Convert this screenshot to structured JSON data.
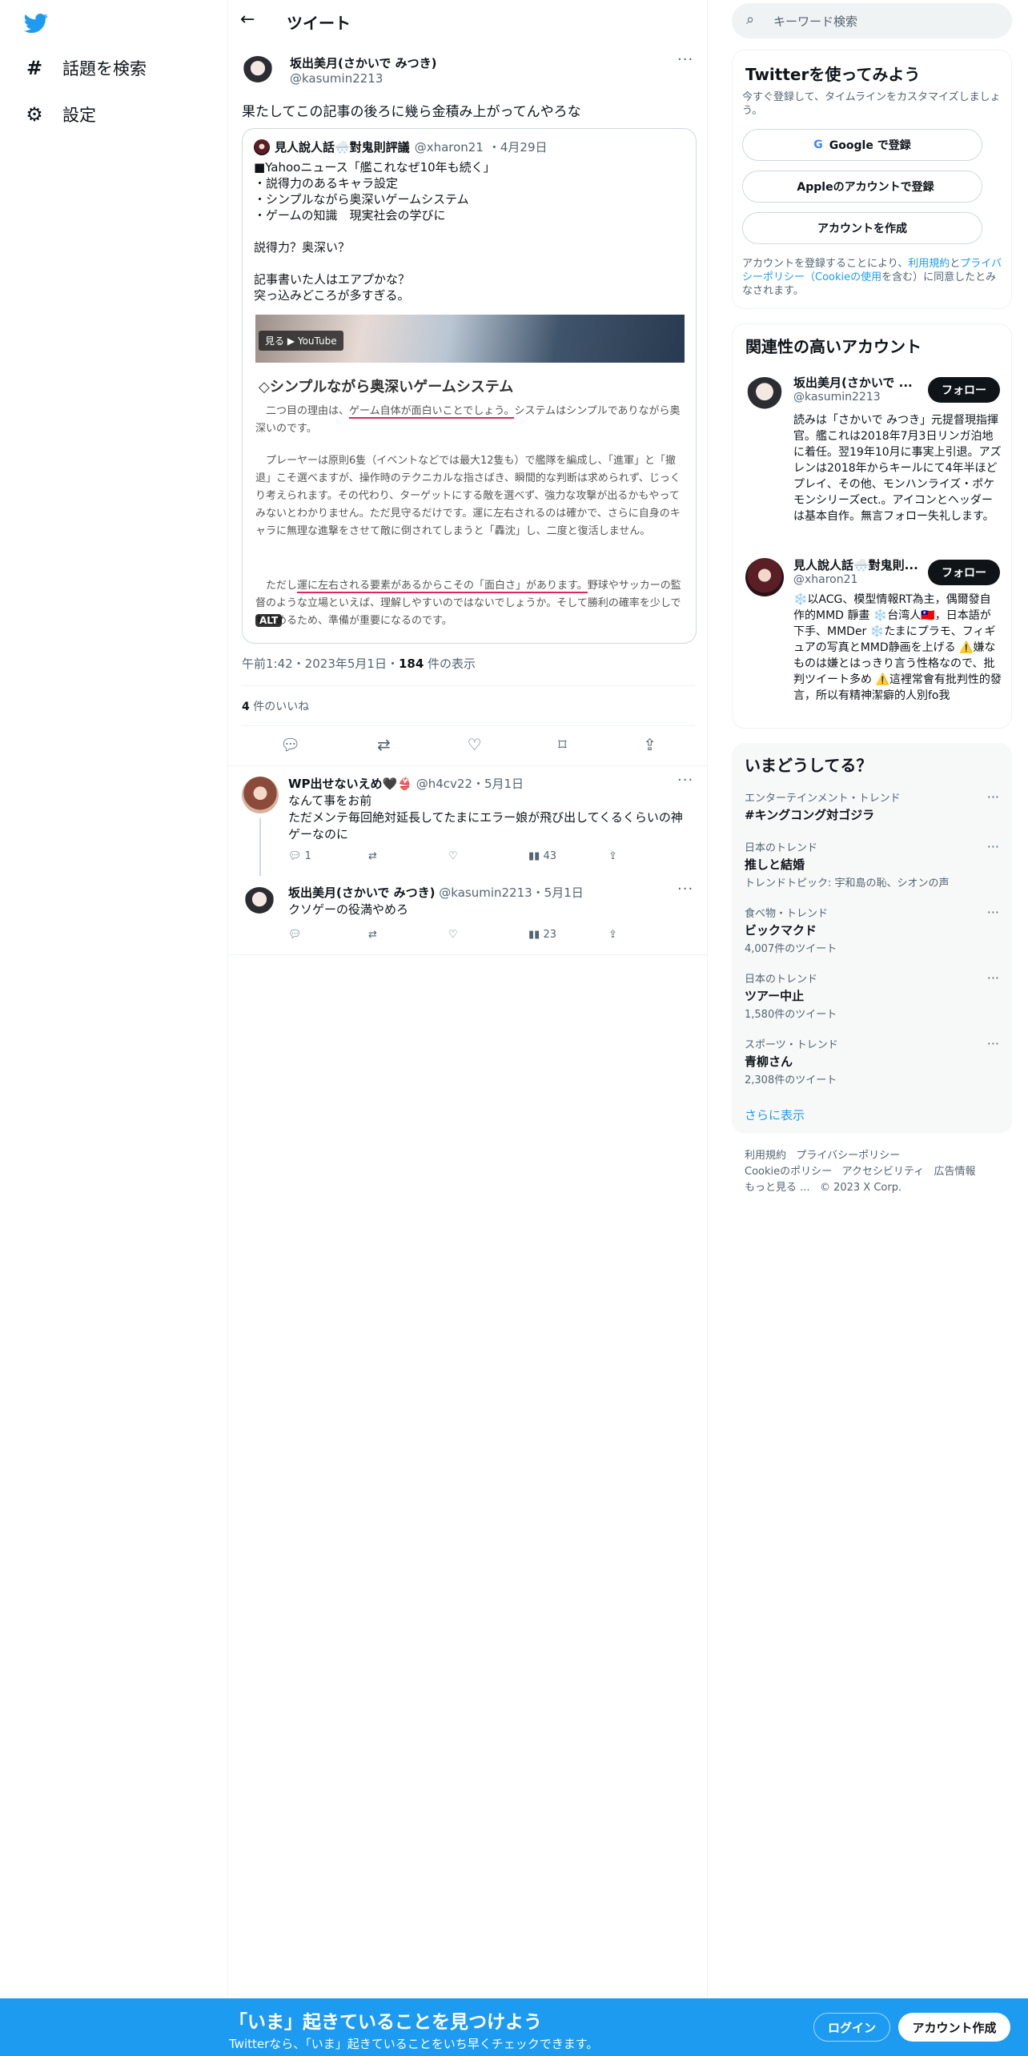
{
  "nav": {
    "explore": "話題を検索",
    "settings": "設定"
  },
  "header": {
    "title": "ツイート"
  },
  "tweet": {
    "name": "坂出美月(さかいで みつき)",
    "handle": "@kasumin2213",
    "text": "果たしてこの記事の後ろに幾ら金積み上がってんやろな",
    "timestamp": "午前1:42・2023年5月1日・",
    "views_count": "184",
    "views_label": " 件の表示",
    "likes_count": "4",
    "likes_label": " 件のいいね"
  },
  "quote": {
    "name": "見人說人話🌨️對鬼則評議",
    "handle": "@xharon21",
    "date": "・4月29日",
    "body": "■Yahooニュース「艦これなぜ10年も続く」\n・説得力のあるキャラ設定\n・シンプルながら奥深いゲームシステム\n・ゲームの知識　現実社会の学びに\n\n説得力？奥深い？\n\n記事書いた人はエアプかな？\n突っ込みどころが多すぎる。",
    "video_button": "見る ▶ YouTube",
    "article_heading": "◇シンプルながら奥深いゲームシステム",
    "article_p1_a": "　二つ目の理由は、",
    "article_p1_u": "ゲーム自体が面白いことでしょう。",
    "article_p1_b": "システムはシンプルでありながら奥深いのです。",
    "article_p2": "　プレーヤーは原則6隻（イベントなどでは最大12隻も）で艦隊を編成し、「進軍」と「撤退」こそ選べますが、操作時のテクニカルな指さばき、瞬間的な判断は求められず、じっくり考えられます。その代わり、ターゲットにする敵を選べず、強力な攻撃が出るかもやってみないとわかりません。ただ見守るだけです。運に左右されるのは確かで、さらに自身のキャラに無理な進撃をさせて敵に倒されてしまうと「轟沈」し、二度と復活しません。",
    "article_p3_a": "　ただし",
    "article_p3_u": "運に左右される要素があるからこその「面白さ」があります。",
    "article_p3_b": "野球やサッカーの監督のような立場といえば、理解しやすいのではないでしょうか。そして勝利の確率を少しでも高めるため、準備が重要になるのです。",
    "alt_badge": "ALT"
  },
  "replies": [
    {
      "name": "WP出せないえめ🖤👙",
      "handle": "@h4cv22",
      "date": "・5月1日",
      "text": "なんて事をお前\nただメンテ毎回絶対延長してたまにエラー娘が飛び出してくるくらいの神ゲーなのに",
      "reply_count": "1",
      "view_count": "43"
    },
    {
      "name": "坂出美月(さかいで みつき)",
      "handle": "@kasumin2213",
      "date": "・5月1日",
      "text": "クソゲーの役満やめろ",
      "reply_count": "",
      "view_count": "23"
    }
  ],
  "search": {
    "placeholder": "キーワード検索"
  },
  "signup_card": {
    "title": "Twitterを使ってみよう",
    "subtitle": "今すぐ登録して、タイムラインをカスタマイズしましょう。",
    "google": "Google で登録",
    "apple": "Appleのアカウントで登録",
    "create": "アカウントを作成",
    "terms_a": "アカウントを登録することにより、",
    "terms_link1": "利用規約",
    "terms_b": "と",
    "terms_link2": "プライバシーポリシー",
    "terms_link3": "（Cookieの使用",
    "terms_c": "を含む）に同意したとみなされます。"
  },
  "related": {
    "title": "関連性の高いアカウント",
    "follow_label": "フォロー",
    "accounts": [
      {
        "name": "坂出美月(さかいで ...",
        "handle": "@kasumin2213",
        "bio": "読みは「さかいで みつき」元提督現指揮官。艦これは2018年7月3日リンガ泊地に着任。翌19年10月に事実上引退。アズレンは2018年からキールにて4年半ほどプレイ、その他、モンハンライズ・ポケモンシリーズect.。アイコンとヘッダーは基本自作。無言フォロー失礼します。"
      },
      {
        "name": "見人說人話🌨️對鬼則...",
        "handle": "@xharon21",
        "bio": "❄️以ACG、模型情報RT為主，偶爾發自作的MMD 靜畫 ❄️台湾人🇹🇼，日本語が下手、MMDer ❄️たまにプラモ、フィギュアの写真とMMD静画を上げる ⚠️嫌なものは嫌とはっきり言う性格なので、批判ツイート多め ⚠️這裡常會有批判性的發言，所以有精神潔癖的人別fo我"
      }
    ]
  },
  "trends": {
    "title": "いまどうしてる？",
    "items": [
      {
        "category": "エンターテインメント・トレンド",
        "title": "#キングコング対ゴジラ",
        "extra": ""
      },
      {
        "category": "日本のトレンド",
        "title": "推しと結婚",
        "extra": "トレンドトピック: 宇和島の恥、シオンの声"
      },
      {
        "category": "食べ物・トレンド",
        "title": "ビックマクド",
        "extra": "4,007件のツイート"
      },
      {
        "category": "日本のトレンド",
        "title": "ツアー中止",
        "extra": "1,580件のツイート"
      },
      {
        "category": "スポーツ・トレンド",
        "title": "青柳さん",
        "extra": "2,308件のツイート"
      }
    ],
    "show_more": "さらに表示"
  },
  "footer": {
    "terms": "利用規約",
    "privacy": "プライバシーポリシー",
    "cookie": "Cookieのポリシー",
    "accessibility": "アクセシビリティ",
    "ads": "広告情報",
    "more": "もっと見る ...",
    "copyright": "© 2023 X Corp."
  },
  "bottom_bar": {
    "title": "「いま」起きていることを見つけよう",
    "subtitle": "Twitterなら、「いま」起きていることをいち早くチェックできます。",
    "login": "ログイン",
    "signup": "アカウント作成"
  },
  "colors": {
    "brand": "#1d9bf0",
    "text": "#0f1419",
    "muted": "#536471"
  }
}
